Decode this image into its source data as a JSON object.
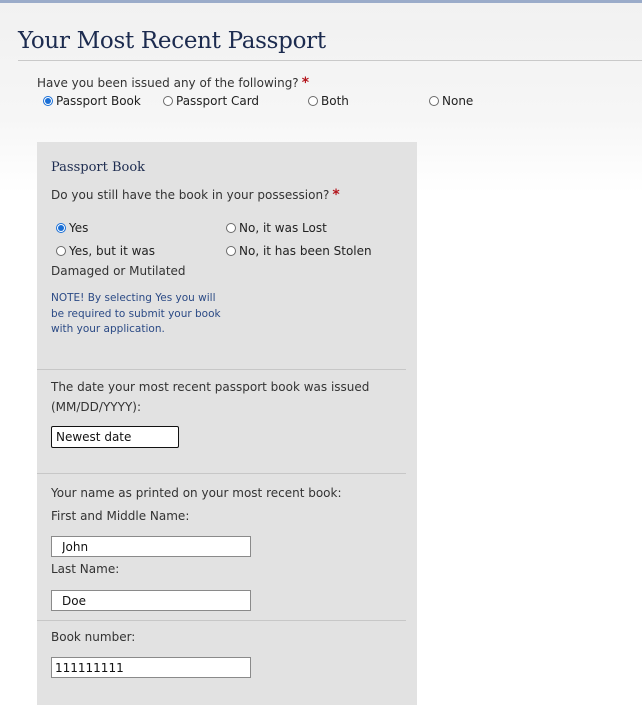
{
  "page": {
    "title": "Your Most Recent Passport"
  },
  "issued_question": {
    "label": "Have you been issued any of the following?",
    "required_mark": "*",
    "options": [
      "Passport Book",
      "Passport Card",
      "Both",
      "None"
    ],
    "selected": "Passport Book"
  },
  "book_section": {
    "title": "Passport Book",
    "possession_question": {
      "label": "Do you still have the book in your possession?",
      "required_mark": "*",
      "options": [
        "Yes",
        "No, it was Lost",
        "Yes, but it was",
        "Damaged or Mutilated",
        "No, it has been Stolen"
      ],
      "selected": "Yes"
    },
    "note": "NOTE! By selecting Yes you will be required to submit your book with your application.",
    "issue_date": {
      "label_line1": "The date your most recent passport book was issued",
      "label_line2": "(MM/DD/YYYY):",
      "value": "Newest date"
    },
    "name": {
      "heading": "Your name as printed on your most recent book:",
      "first_label": "First and Middle Name:",
      "first_value": "John",
      "last_label": "Last Name:",
      "last_value": "Doe"
    },
    "book_number": {
      "label": "Book number:",
      "value": "111111111"
    }
  },
  "colors": {
    "accent": "#1a6fd6",
    "title": "#1c2b4f",
    "required": "#b3141b",
    "note": "#2b4a85",
    "panel": "#e2e2e2"
  }
}
